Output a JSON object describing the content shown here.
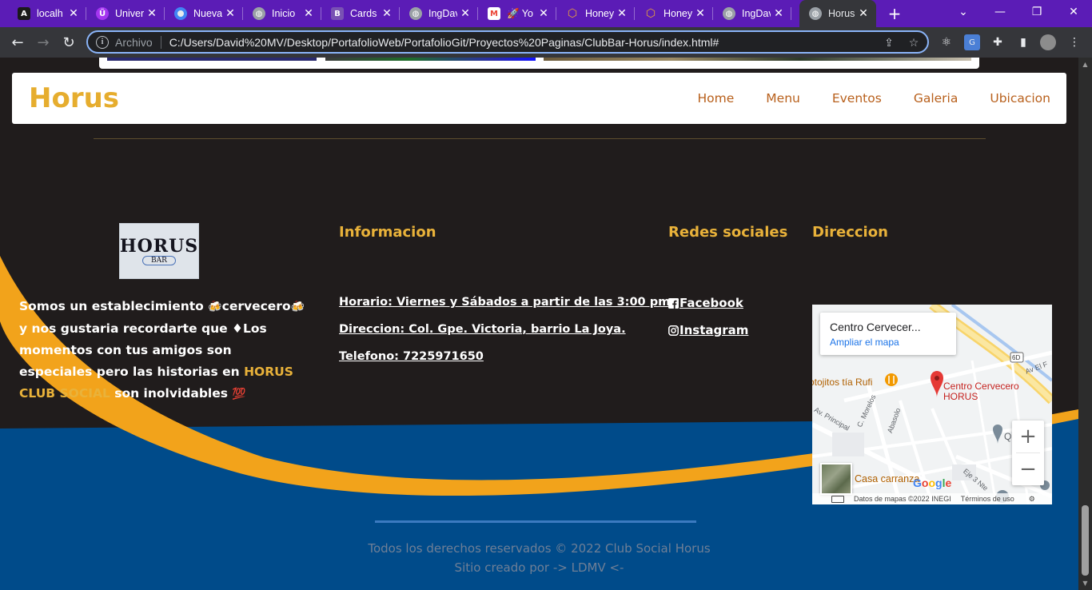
{
  "browser": {
    "tabs": [
      {
        "title": "localh",
        "icon": "angular-icon",
        "color": "#ffffff"
      },
      {
        "title": "Univer",
        "icon": "udemy-icon",
        "color": "#a435f0"
      },
      {
        "title": "Nueva",
        "icon": "chrome-icon",
        "color": "#4285f4"
      },
      {
        "title": "Inicio",
        "icon": "globe-icon",
        "color": "#9aa0a6"
      },
      {
        "title": "Cards",
        "icon": "bootstrap-icon",
        "color": "#7952b3"
      },
      {
        "title": "IngDav",
        "icon": "globe-icon",
        "color": "#9aa0a6"
      },
      {
        "title": "🚀 Yo",
        "icon": "gmail-icon",
        "color": "#ea4335"
      },
      {
        "title": "Honey",
        "icon": "honey-icon",
        "color": "#e8a33a"
      },
      {
        "title": "Honey",
        "icon": "honey-icon",
        "color": "#e8a33a"
      },
      {
        "title": "IngDav",
        "icon": "globe-icon",
        "color": "#9aa0a6"
      },
      {
        "title": "Horus",
        "icon": "globe-icon",
        "color": "#9aa0a6",
        "active": true
      }
    ],
    "omnibox": {
      "scheme": "Archivo",
      "url": "C:/Users/David%20MV/Desktop/PortafolioWeb/PortafolioGit/Proyectos%20Paginas/ClubBar-Horus/index.html#"
    }
  },
  "page": {
    "navbar": {
      "brand": "Horus",
      "links": [
        "Home",
        "Menu",
        "Eventos",
        "Galeria",
        "Ubicacion"
      ]
    },
    "footer": {
      "logo": {
        "word": "HORUS",
        "sub": "BAR"
      },
      "about": {
        "part1": "Somos un establecimiento ",
        "emoji_beer": "🍻",
        "part2": "cervecero",
        "part3": " y nos gustaria recordarte que ",
        "diamond": "♦",
        "part4": "Los momentos con tus amigos son especiales pero las historias en ",
        "highlight": "HORUS CLUB SOCIAL",
        "part5": " son inolvidables ",
        "emoji_100": "💯"
      },
      "headings": {
        "info": "Informacion",
        "social": "Redes sociales",
        "address": "Direccion"
      },
      "info_lines": [
        "Horario: Viernes y Sábados a partir de las 3:00 pm",
        "Direccion: Col. Gpe. Victoria, barrio La Joya.",
        "Telefono: 7225971650"
      ],
      "social_links": [
        "Facebook",
        "Instagram"
      ],
      "map": {
        "place": "Centro Cervecer...",
        "enlarge": "Ampliar el mapa",
        "pin_label_1": "Centro Cervecero",
        "pin_label_2": "HORUS",
        "poi_1": "otojitos tía Rufi",
        "poi_2": "Casa carranza",
        "poi_3": "Q",
        "streets": [
          "Av. Principal",
          "C. Morelos",
          "Abasolo",
          "Eje 3 Nte",
          "Av El F",
          "6D"
        ],
        "footer_data": "Datos de mapas ©2022 INEGI",
        "footer_terms": "Términos de uso",
        "google": "Google"
      },
      "copyright": "Todos los derechos reservados © 2022 Club Social Horus",
      "credit": "Sitio creado por -> LDMV <-"
    }
  }
}
